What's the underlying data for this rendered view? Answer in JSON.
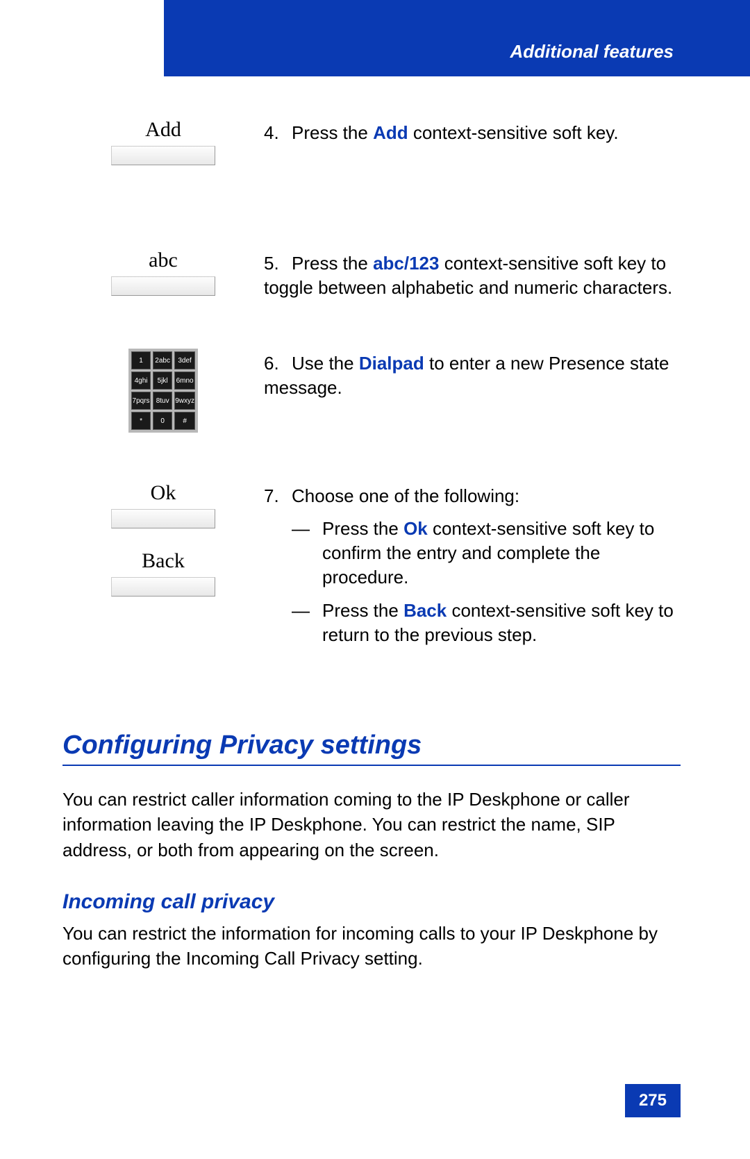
{
  "header": {
    "title": "Additional features"
  },
  "steps": {
    "s4": {
      "label": "Add",
      "num": "4.",
      "pre": "Press the ",
      "kw": "Add",
      "post": " context-sensitive soft key."
    },
    "s5": {
      "label": "abc",
      "num": "5.",
      "pre": "Press the ",
      "kw": "abc/123",
      "post": " context-sensitive soft key to toggle between alphabetic and numeric characters."
    },
    "s6": {
      "num": "6.",
      "pre": "Use the ",
      "kw": "Dialpad",
      "post": " to enter a new Presence state message."
    },
    "s7": {
      "label_ok": "Ok",
      "label_back": "Back",
      "num": "7.",
      "intro": "Choose one of the following:",
      "a_pre": "Press the ",
      "a_kw": "Ok",
      "a_post": " context-sensitive soft key to confirm the entry and complete the procedure.",
      "b_pre": "Press the ",
      "b_kw": "Back",
      "b_post": " context-sensitive soft key to return to the previous step."
    }
  },
  "dialpad": {
    "k1": "1",
    "k2": "2abc",
    "k3": "3def",
    "k4": "4ghi",
    "k5": "5jkl",
    "k6": "6mno",
    "k7": "7pqrs",
    "k8": "8tuv",
    "k9": "9wxyz",
    "ks": "*",
    "k0": "0",
    "kh": "#"
  },
  "sections": {
    "h1": "Configuring Privacy settings",
    "p1": "You can restrict caller information coming to the IP Deskphone or caller information leaving the IP Deskphone. You can restrict the name, SIP address, or both from appearing on the screen.",
    "h2": "Incoming call privacy",
    "p2": "You can restrict the information for incoming calls to your IP Deskphone by configuring the Incoming Call Privacy setting."
  },
  "dash": "—",
  "page": "275"
}
